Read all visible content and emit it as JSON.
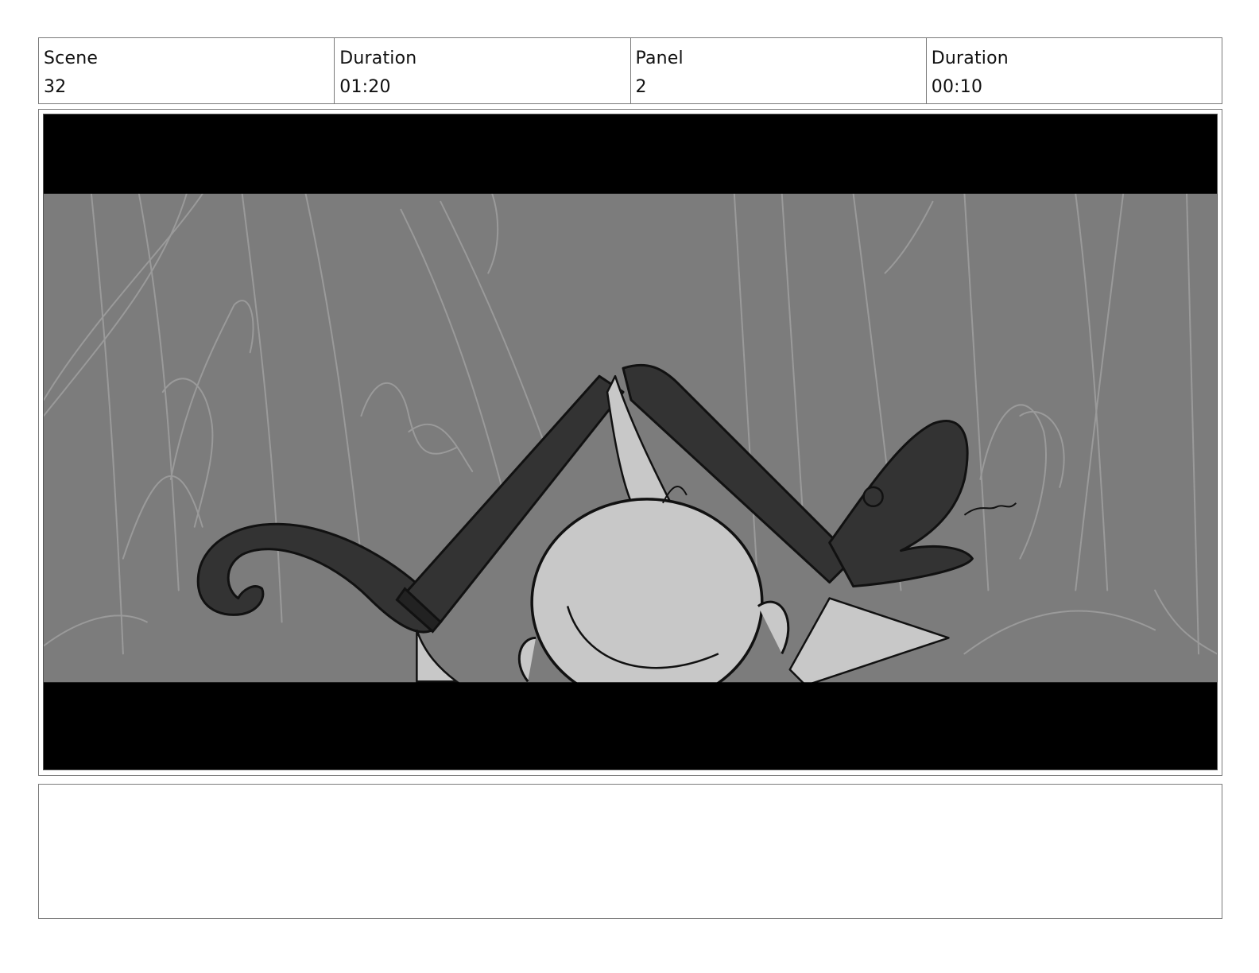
{
  "header": {
    "scene_label": "Scene",
    "scene_value": "32",
    "scene_duration_label": "Duration",
    "scene_duration_value": "01:20",
    "panel_label": "Panel",
    "panel_value": "2",
    "panel_duration_label": "Duration",
    "panel_duration_value": "00:10"
  },
  "panel": {
    "background_color": "#7c7c7c",
    "letterbox_color": "#000000",
    "limb_color": "#333333",
    "character_color": "#c8c8c8"
  },
  "notes": {
    "text": ""
  }
}
